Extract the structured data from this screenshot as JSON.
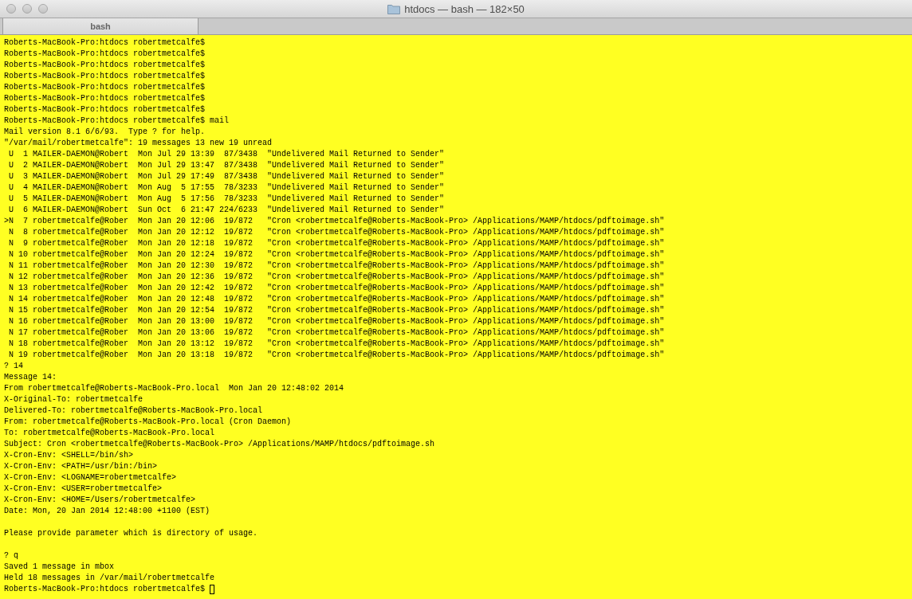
{
  "window": {
    "title": "htdocs — bash — 182×50"
  },
  "tabs": [
    {
      "label": "bash",
      "selected": true
    }
  ],
  "terminal": {
    "cursor": true,
    "lines": [
      {
        "kind": "text",
        "text": "Roberts-MacBook-Pro:htdocs robertmetcalfe$"
      },
      {
        "kind": "text",
        "text": "Roberts-MacBook-Pro:htdocs robertmetcalfe$"
      },
      {
        "kind": "text",
        "text": "Roberts-MacBook-Pro:htdocs robertmetcalfe$"
      },
      {
        "kind": "text",
        "text": "Roberts-MacBook-Pro:htdocs robertmetcalfe$"
      },
      {
        "kind": "text",
        "text": "Roberts-MacBook-Pro:htdocs robertmetcalfe$"
      },
      {
        "kind": "text",
        "text": "Roberts-MacBook-Pro:htdocs robertmetcalfe$"
      },
      {
        "kind": "text",
        "text": "Roberts-MacBook-Pro:htdocs robertmetcalfe$"
      },
      {
        "kind": "text",
        "text": "Roberts-MacBook-Pro:htdocs robertmetcalfe$ mail"
      },
      {
        "kind": "text",
        "text": "Mail version 8.1 6/6/93.  Type ? for help."
      },
      {
        "kind": "text",
        "text": "\"/var/mail/robertmetcalfe\": 19 messages 13 new 19 unread"
      },
      {
        "kind": "text",
        "text": " U  1 MAILER-DAEMON@Robert  Mon Jul 29 13:39  87/3438  \"Undelivered Mail Returned to Sender\""
      },
      {
        "kind": "text",
        "text": " U  2 MAILER-DAEMON@Robert  Mon Jul 29 13:47  87/3438  \"Undelivered Mail Returned to Sender\""
      },
      {
        "kind": "text",
        "text": " U  3 MAILER-DAEMON@Robert  Mon Jul 29 17:49  87/3438  \"Undelivered Mail Returned to Sender\""
      },
      {
        "kind": "text",
        "text": " U  4 MAILER-DAEMON@Robert  Mon Aug  5 17:55  78/3233  \"Undelivered Mail Returned to Sender\""
      },
      {
        "kind": "text",
        "text": " U  5 MAILER-DAEMON@Robert  Mon Aug  5 17:56  78/3233  \"Undelivered Mail Returned to Sender\""
      },
      {
        "kind": "text",
        "text": " U  6 MAILER-DAEMON@Robert  Sun Oct  6 21:47 224/6233  \"Undelivered Mail Returned to Sender\""
      },
      {
        "kind": "text",
        "text": ">N  7 robertmetcalfe@Rober  Mon Jan 20 12:06  19/872   \"Cron <robertmetcalfe@Roberts-MacBook-Pro> /Applications/MAMP/htdocs/pdftoimage.sh\""
      },
      {
        "kind": "text",
        "text": " N  8 robertmetcalfe@Rober  Mon Jan 20 12:12  19/872   \"Cron <robertmetcalfe@Roberts-MacBook-Pro> /Applications/MAMP/htdocs/pdftoimage.sh\""
      },
      {
        "kind": "text",
        "text": " N  9 robertmetcalfe@Rober  Mon Jan 20 12:18  19/872   \"Cron <robertmetcalfe@Roberts-MacBook-Pro> /Applications/MAMP/htdocs/pdftoimage.sh\""
      },
      {
        "kind": "text",
        "text": " N 10 robertmetcalfe@Rober  Mon Jan 20 12:24  19/872   \"Cron <robertmetcalfe@Roberts-MacBook-Pro> /Applications/MAMP/htdocs/pdftoimage.sh\""
      },
      {
        "kind": "text",
        "text": " N 11 robertmetcalfe@Rober  Mon Jan 20 12:30  19/872   \"Cron <robertmetcalfe@Roberts-MacBook-Pro> /Applications/MAMP/htdocs/pdftoimage.sh\""
      },
      {
        "kind": "text",
        "text": " N 12 robertmetcalfe@Rober  Mon Jan 20 12:36  19/872   \"Cron <robertmetcalfe@Roberts-MacBook-Pro> /Applications/MAMP/htdocs/pdftoimage.sh\""
      },
      {
        "kind": "text",
        "text": " N 13 robertmetcalfe@Rober  Mon Jan 20 12:42  19/872   \"Cron <robertmetcalfe@Roberts-MacBook-Pro> /Applications/MAMP/htdocs/pdftoimage.sh\""
      },
      {
        "kind": "text",
        "text": " N 14 robertmetcalfe@Rober  Mon Jan 20 12:48  19/872   \"Cron <robertmetcalfe@Roberts-MacBook-Pro> /Applications/MAMP/htdocs/pdftoimage.sh\""
      },
      {
        "kind": "text",
        "text": " N 15 robertmetcalfe@Rober  Mon Jan 20 12:54  19/872   \"Cron <robertmetcalfe@Roberts-MacBook-Pro> /Applications/MAMP/htdocs/pdftoimage.sh\""
      },
      {
        "kind": "text",
        "text": " N 16 robertmetcalfe@Rober  Mon Jan 20 13:00  19/872   \"Cron <robertmetcalfe@Roberts-MacBook-Pro> /Applications/MAMP/htdocs/pdftoimage.sh\""
      },
      {
        "kind": "text",
        "text": " N 17 robertmetcalfe@Rober  Mon Jan 20 13:06  19/872   \"Cron <robertmetcalfe@Roberts-MacBook-Pro> /Applications/MAMP/htdocs/pdftoimage.sh\""
      },
      {
        "kind": "text",
        "text": " N 18 robertmetcalfe@Rober  Mon Jan 20 13:12  19/872   \"Cron <robertmetcalfe@Roberts-MacBook-Pro> /Applications/MAMP/htdocs/pdftoimage.sh\""
      },
      {
        "kind": "text",
        "text": " N 19 robertmetcalfe@Rober  Mon Jan 20 13:18  19/872   \"Cron <robertmetcalfe@Roberts-MacBook-Pro> /Applications/MAMP/htdocs/pdftoimage.sh\""
      },
      {
        "kind": "text",
        "text": "? 14"
      },
      {
        "kind": "text",
        "text": "Message 14:"
      },
      {
        "kind": "text",
        "text": "From robertmetcalfe@Roberts-MacBook-Pro.local  Mon Jan 20 12:48:02 2014"
      },
      {
        "kind": "text",
        "text": "X-Original-To: robertmetcalfe"
      },
      {
        "kind": "text",
        "text": "Delivered-To: robertmetcalfe@Roberts-MacBook-Pro.local"
      },
      {
        "kind": "text",
        "text": "From: robertmetcalfe@Roberts-MacBook-Pro.local (Cron Daemon)"
      },
      {
        "kind": "text",
        "text": "To: robertmetcalfe@Roberts-MacBook-Pro.local"
      },
      {
        "kind": "text",
        "text": "Subject: Cron <robertmetcalfe@Roberts-MacBook-Pro> /Applications/MAMP/htdocs/pdftoimage.sh"
      },
      {
        "kind": "text",
        "text": "X-Cron-Env: <SHELL=/bin/sh>"
      },
      {
        "kind": "text",
        "text": "X-Cron-Env: <PATH=/usr/bin:/bin>"
      },
      {
        "kind": "text",
        "text": "X-Cron-Env: <LOGNAME=robertmetcalfe>"
      },
      {
        "kind": "text",
        "text": "X-Cron-Env: <USER=robertmetcalfe>"
      },
      {
        "kind": "text",
        "text": "X-Cron-Env: <HOME=/Users/robertmetcalfe>"
      },
      {
        "kind": "text",
        "text": "Date: Mon, 20 Jan 2014 12:48:00 +1100 (EST)"
      },
      {
        "kind": "blank"
      },
      {
        "kind": "text",
        "text": "Please provide parameter which is directory of usage."
      },
      {
        "kind": "blank"
      },
      {
        "kind": "text",
        "text": "? q"
      },
      {
        "kind": "text",
        "text": "Saved 1 message in mbox"
      },
      {
        "kind": "text",
        "text": "Held 18 messages in /var/mail/robertmetcalfe"
      },
      {
        "kind": "text",
        "text": "Roberts-MacBook-Pro:htdocs robertmetcalfe$"
      }
    ]
  }
}
